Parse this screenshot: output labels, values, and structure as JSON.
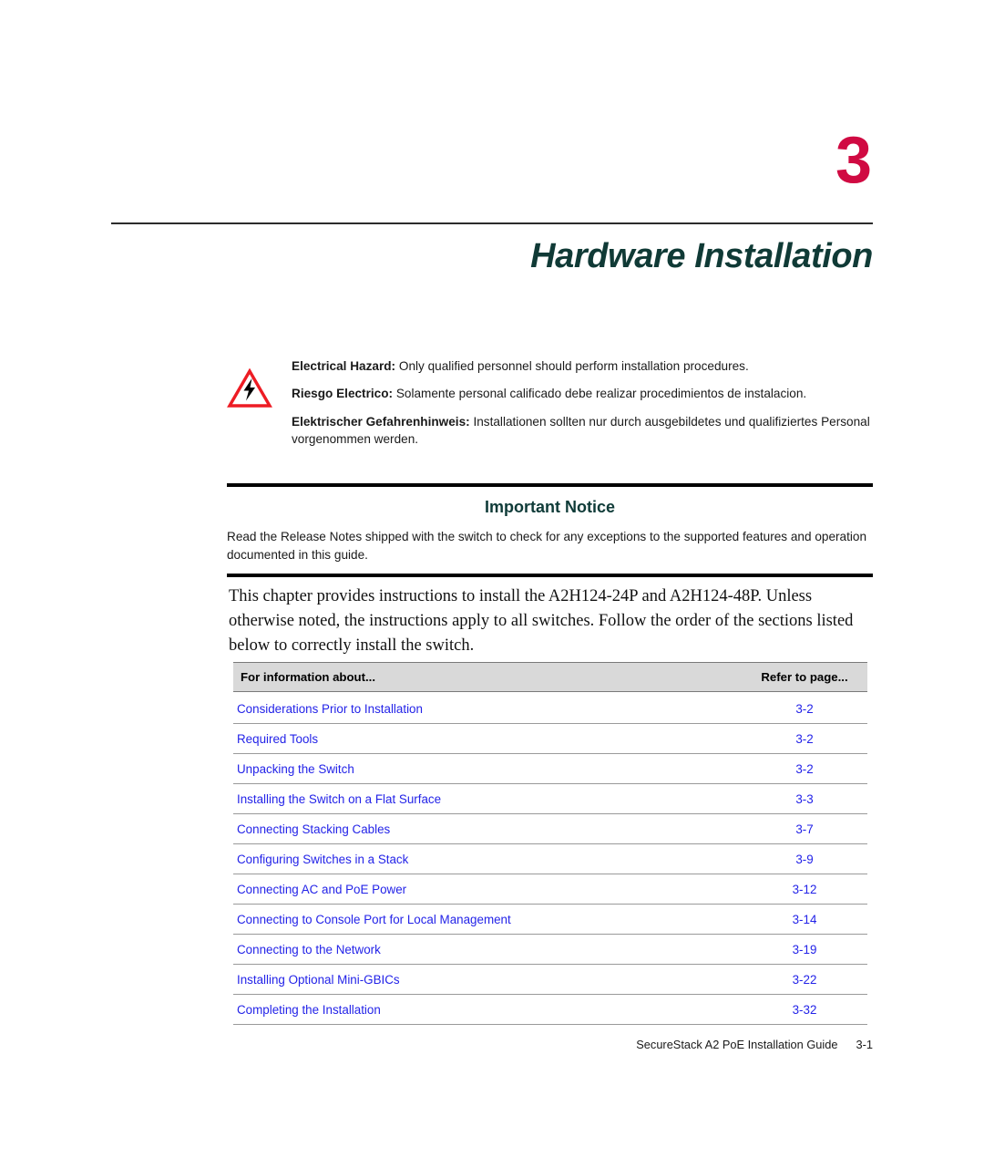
{
  "chapter": {
    "number": "3",
    "title": "Hardware Installation"
  },
  "hazard": {
    "icon": "electrical-hazard-triangle-icon",
    "icon_colors": {
      "triangle": "#ED1C24",
      "bolt": "#000000"
    },
    "notices": [
      {
        "label": "Electrical Hazard:",
        "text": " Only qualified personnel should perform installation procedures."
      },
      {
        "label": "Riesgo Electrico:",
        "text": " Solamente personal calificado debe realizar procedimientos de instalacion."
      },
      {
        "label": "Elektrischer Gefahrenhinweis:",
        "text": " Installationen sollten nur durch ausgebildetes und qualifiziertes Personal vorgenommen werden."
      }
    ]
  },
  "important_notice": {
    "title": "Important Notice",
    "body": "Read the Release Notes shipped with the switch to check for any exceptions to the supported features and operation documented in this guide."
  },
  "intro": {
    "paragraph": "This chapter provides instructions to install the A2H124-24P and A2H124-48P. Unless otherwise noted, the instructions apply to all switches. Follow the order of the sections listed below to correctly install the switch."
  },
  "reference_table": {
    "headers": {
      "topic": "For information about...",
      "page": "Refer to page..."
    },
    "rows": [
      {
        "topic": "Considerations Prior to Installation",
        "page": "3-2"
      },
      {
        "topic": "Required Tools",
        "page": "3-2"
      },
      {
        "topic": "Unpacking the Switch",
        "page": "3-2"
      },
      {
        "topic": "Installing the Switch on a Flat Surface",
        "page": "3-3"
      },
      {
        "topic": "Connecting Stacking Cables",
        "page": "3-7"
      },
      {
        "topic": "Configuring Switches in a Stack",
        "page": "3-9"
      },
      {
        "topic": "Connecting AC and PoE Power",
        "page": "3-12"
      },
      {
        "topic": "Connecting to Console Port for Local Management",
        "page": "3-14"
      },
      {
        "topic": "Connecting to the Network",
        "page": "3-19"
      },
      {
        "topic": "Installing Optional Mini-GBICs",
        "page": "3-22"
      },
      {
        "topic": "Completing the Installation",
        "page": "3-32"
      }
    ]
  },
  "footer": {
    "guide_title": "SecureStack A2 PoE Installation Guide",
    "page_number": "3-1"
  },
  "colors": {
    "chapter_number": "#D00A42",
    "chapter_title": "#103A36",
    "notice_title": "#0F3B38",
    "link": "#2323E8",
    "table_header_bg": "#d9d9d9"
  }
}
